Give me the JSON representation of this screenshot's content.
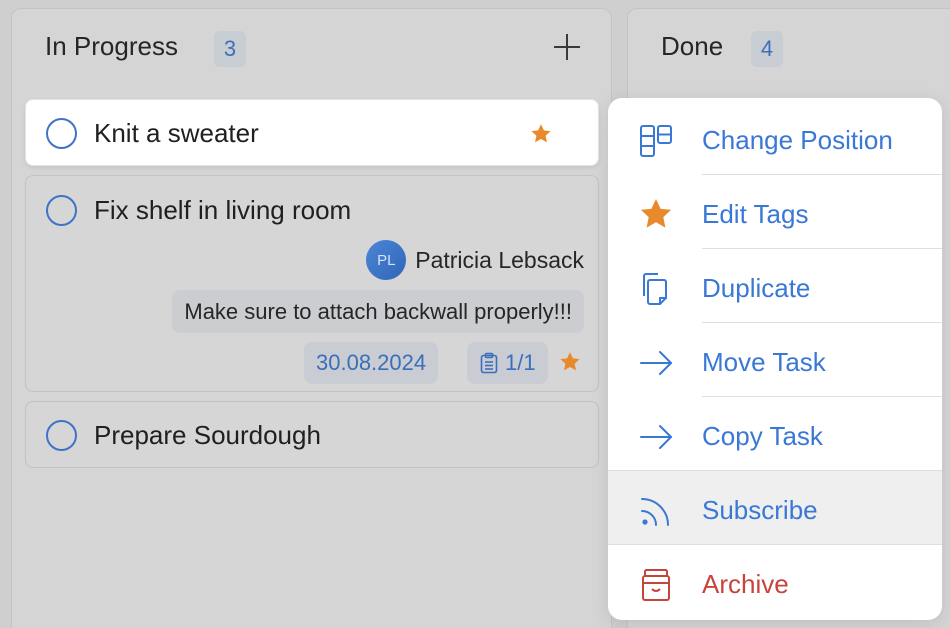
{
  "columns": {
    "in_progress": {
      "title": "In Progress",
      "count": "3",
      "add_icon": "plus-icon",
      "cards": [
        {
          "title": "Knit a sweater",
          "starred": true
        },
        {
          "title": "Fix shelf in living room",
          "assignee": {
            "initials": "PL",
            "name": "Patricia Lebsack"
          },
          "note": "Make sure to attach backwall properly!!!",
          "due_date": "30.08.2024",
          "checklist": "1/1",
          "starred": true
        },
        {
          "title": "Prepare Sourdough",
          "starred": false
        }
      ]
    },
    "done": {
      "title": "Done",
      "count": "4"
    }
  },
  "context_menu": {
    "items": [
      {
        "label": "Change Position",
        "icon": "layout-grid-icon"
      },
      {
        "label": "Edit Tags",
        "icon": "star-icon"
      },
      {
        "label": "Duplicate",
        "icon": "duplicate-icon"
      },
      {
        "label": "Move Task",
        "icon": "arrow-right-icon"
      },
      {
        "label": "Copy Task",
        "icon": "arrow-right-icon"
      },
      {
        "label": "Subscribe",
        "icon": "rss-icon"
      },
      {
        "label": "Archive",
        "icon": "archive-box-icon"
      }
    ]
  },
  "colors": {
    "accent": "#3a78d6",
    "star": "#e88a2b",
    "danger": "#c5453c",
    "board_bg": "#cfcfd0"
  }
}
